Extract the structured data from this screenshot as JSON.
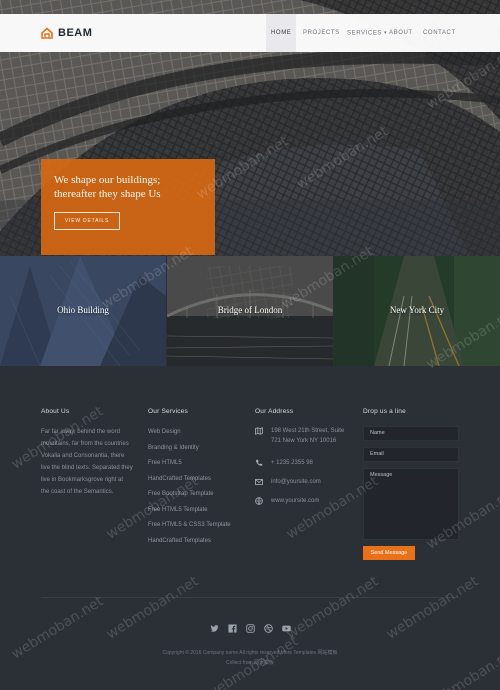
{
  "brand": {
    "name": "BEAM"
  },
  "nav": {
    "items": [
      {
        "label": "HOME"
      },
      {
        "label": "PROJECTS"
      },
      {
        "label": "SERVICES"
      },
      {
        "label": "ABOUT"
      },
      {
        "label": "CONTACT"
      }
    ],
    "active": "HOME"
  },
  "hero": {
    "title_line1": "We shape our buildings;",
    "title_line2": "thereafter they shape Us",
    "button_label": "VIEW DETAILS",
    "accent_color": "#d66814"
  },
  "tiles": [
    {
      "caption": "Ohio Building"
    },
    {
      "caption": "Bridge of London"
    },
    {
      "caption": "New York City"
    }
  ],
  "footer": {
    "about": {
      "title": "About Us",
      "text": "Far far away, behind the word mountains, far from the countries Vokalia and Consonantia, there live the blind texts. Separated they live in Bookmarksgrove right at the coast of the Semantics."
    },
    "services": {
      "title": "Our Services",
      "items": [
        "Web Design",
        "Branding & Identity",
        "Free HTML5",
        "HandCrafted Templates",
        "Free Bootstrap Template",
        "Free HTML5 Template",
        "Free HTML5 & CSS3 Template",
        "HandCrafted Templates"
      ]
    },
    "address": {
      "title": "Our Address",
      "street": "198 West 21th Street, Suite 721 New York NY 10016",
      "phone": "+ 1235 2355 98",
      "email": "info@yoursite.com",
      "website": "www.yoursite.com"
    },
    "contact": {
      "title": "Drop us a line",
      "name_placeholder": "Name",
      "email_placeholder": "Email",
      "message_placeholder": "Message",
      "send_label": "Send Message"
    },
    "copyright_line1": "Copyright © 2016 Company name All rights reserved.More Templates 网站模板",
    "copyright_line2": "Collect from 网页模板"
  },
  "social_icons": [
    "twitter-icon",
    "facebook-icon",
    "instagram-icon",
    "dribbble-icon",
    "youtube-icon"
  ],
  "watermark": "webmoban.net",
  "colors": {
    "accent": "#e8711a",
    "footer_bg": "#2b2f36"
  }
}
